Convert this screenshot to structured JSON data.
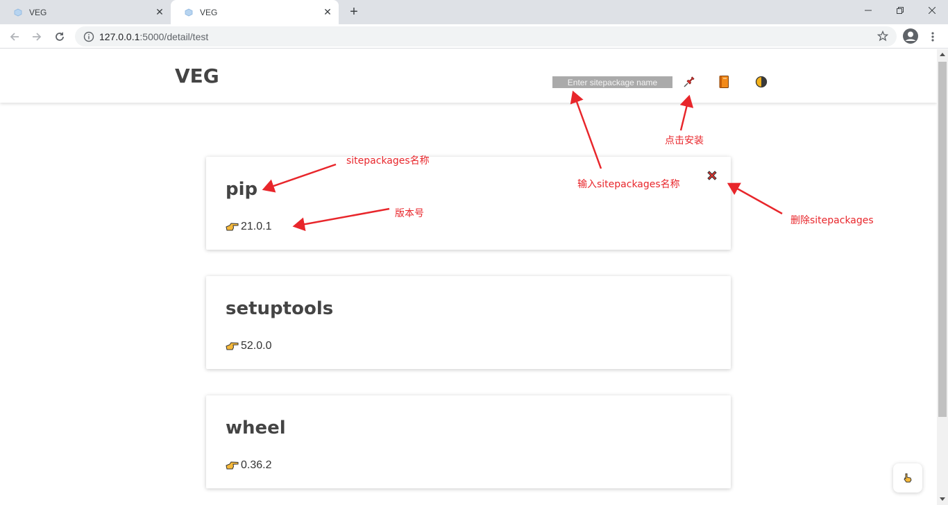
{
  "browser": {
    "tabs": [
      {
        "title": "VEG",
        "active": false
      },
      {
        "title": "VEG",
        "active": true
      }
    ],
    "url_host": "127.0.0.1",
    "url_path": ":5000/detail/test"
  },
  "header": {
    "brand": "VEG",
    "search_placeholder": "Enter sitepackage name",
    "icons": [
      "pushpin-icon",
      "book-icon",
      "theme-toggle-icon"
    ]
  },
  "packages": [
    {
      "name": "pip",
      "version": "21.0.1"
    },
    {
      "name": "setuptools",
      "version": "52.0.0"
    },
    {
      "name": "wheel",
      "version": "0.36.2"
    }
  ],
  "annotations": {
    "install": "点击安装",
    "pkg_name": "sitepackages名称",
    "input_name": "输入sitepackages名称",
    "version": "版本号",
    "delete": "删除sitepackages"
  },
  "colors": {
    "annotation": "#e8262b",
    "search_bg": "#aaaaaa",
    "heading": "#444444"
  }
}
